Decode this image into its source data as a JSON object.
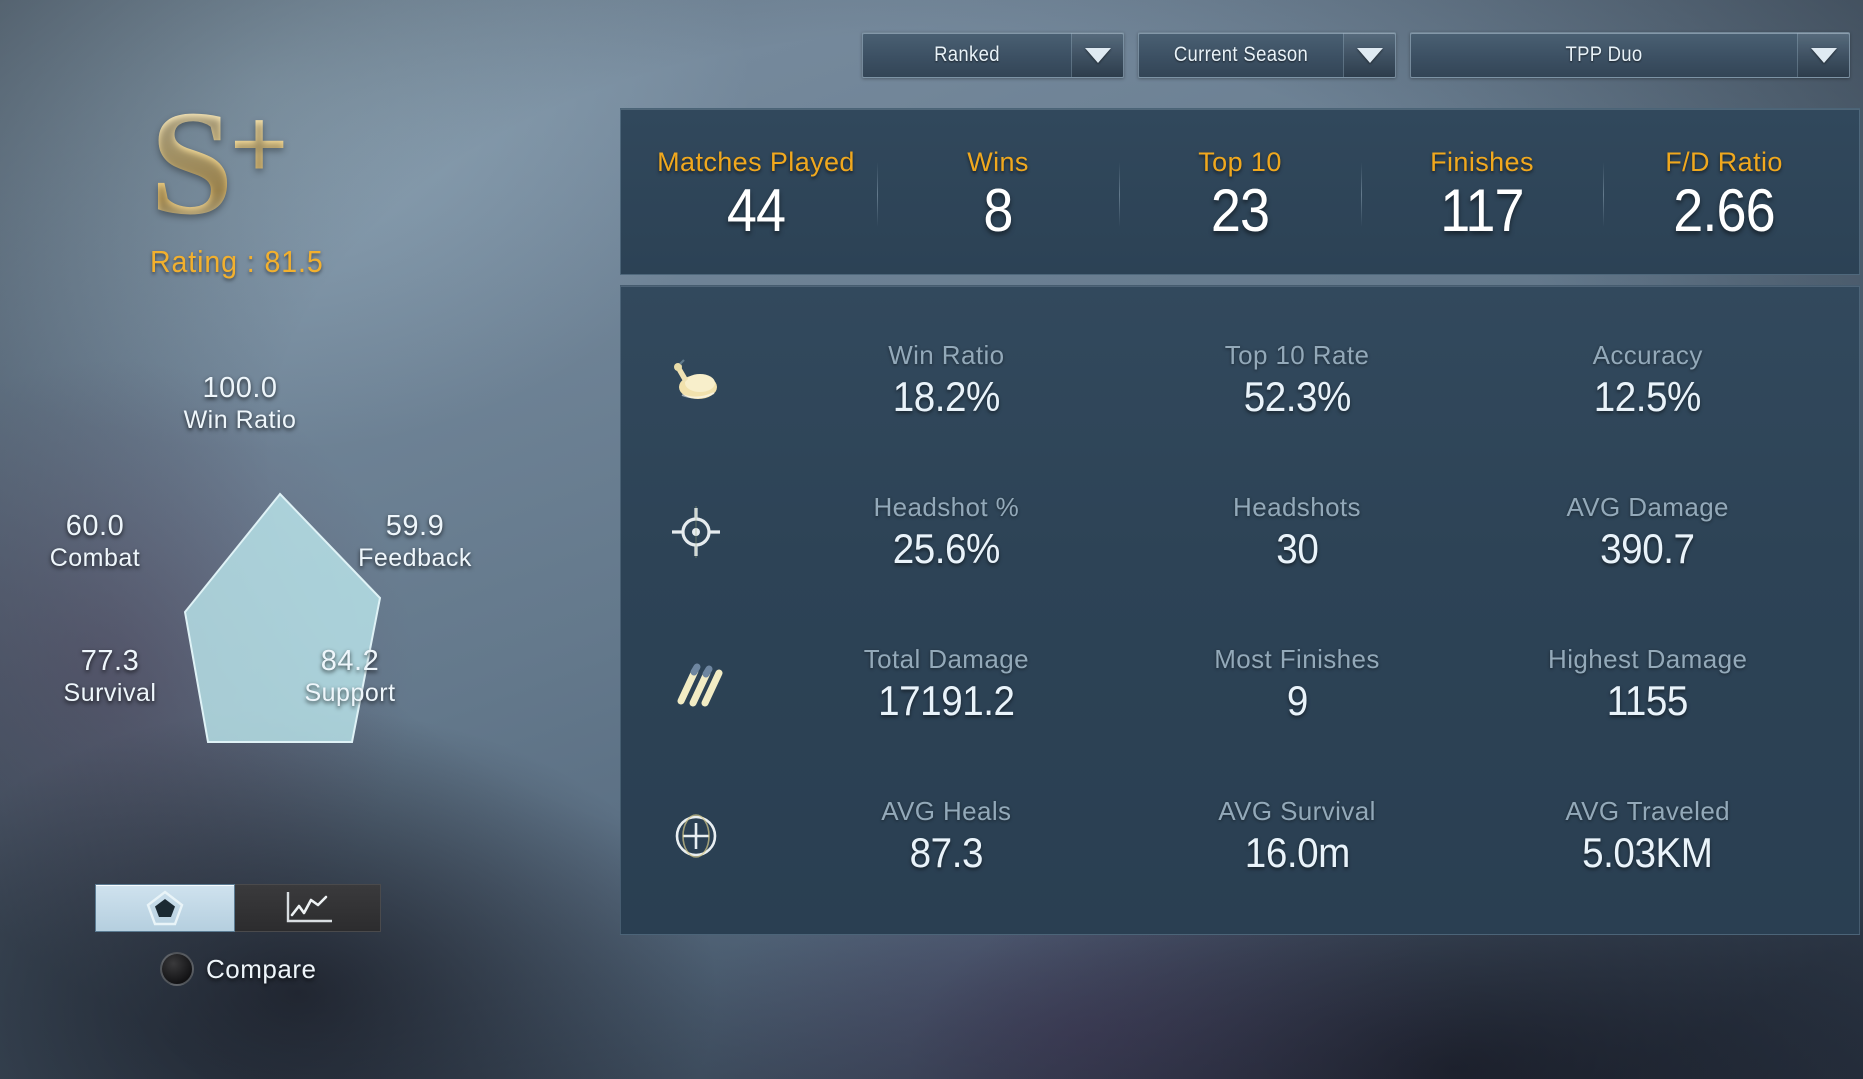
{
  "filters": [
    {
      "name": "match-type",
      "value": "Ranked"
    },
    {
      "name": "season",
      "value": "Current Season"
    },
    {
      "name": "mode",
      "value": "TPP Duo"
    }
  ],
  "rank": {
    "tier": "S",
    "plus": "+",
    "rating_text": "Rating : 81.5"
  },
  "summary": [
    {
      "label": "Matches Played",
      "value": "44"
    },
    {
      "label": "Wins",
      "value": "8"
    },
    {
      "label": "Top 10",
      "value": "23"
    },
    {
      "label": "Finishes",
      "value": "117"
    },
    {
      "label": "F/D Ratio",
      "value": "2.66"
    }
  ],
  "detail_rows": [
    {
      "icon": "chicken-dinner-icon",
      "cells": [
        {
          "label": "Win Ratio",
          "value": "18.2%"
        },
        {
          "label": "Top 10 Rate",
          "value": "52.3%"
        },
        {
          "label": "Accuracy",
          "value": "12.5%"
        }
      ]
    },
    {
      "icon": "crosshair-icon",
      "cells": [
        {
          "label": "Headshot %",
          "value": "25.6%"
        },
        {
          "label": "Headshots",
          "value": "30"
        },
        {
          "label": "AVG Damage",
          "value": "390.7"
        }
      ]
    },
    {
      "icon": "bullets-icon",
      "cells": [
        {
          "label": "Total Damage",
          "value": "17191.2"
        },
        {
          "label": "Most Finishes",
          "value": "9"
        },
        {
          "label": "Highest Damage",
          "value": "1155"
        }
      ]
    },
    {
      "icon": "medkit-plus-icon",
      "cells": [
        {
          "label": "AVG Heals",
          "value": "87.3"
        },
        {
          "label": "AVG Survival",
          "value": "16.0m"
        },
        {
          "label": "AVG Traveled",
          "value": "5.03KM"
        }
      ]
    }
  ],
  "compare": {
    "label": "Compare"
  },
  "colors": {
    "accent_gold": "#f0a81e",
    "rating_gold": "#f2b02e",
    "panel": "#2d4356",
    "radar_fill": "#b9e4ea",
    "value_text": "#e9f3fa",
    "label_text": "#93a9b9"
  },
  "chart_data": {
    "type": "radar",
    "title": "",
    "categories": [
      "Win Ratio",
      "Feedback",
      "Support",
      "Survival",
      "Combat"
    ],
    "values": [
      100.0,
      59.9,
      84.2,
      77.3,
      60.0
    ],
    "value_labels": [
      "100.0",
      "59.9",
      "84.2",
      "77.3",
      "60.0"
    ],
    "range": [
      0,
      100
    ],
    "grid": false,
    "legend": "none",
    "fill_color": "#b9e4ea"
  }
}
